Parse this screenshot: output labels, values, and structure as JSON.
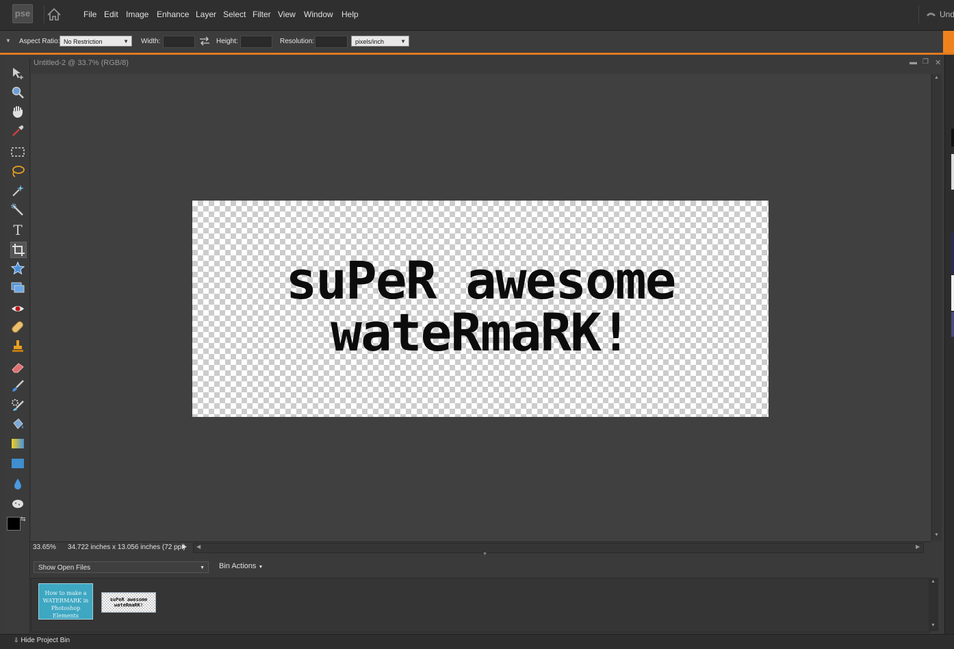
{
  "app": {
    "logo": "pse"
  },
  "menu": [
    "File",
    "Edit",
    "Image",
    "Enhance",
    "Layer",
    "Select",
    "Filter",
    "View",
    "Window",
    "Help"
  ],
  "undo_label": "Und",
  "options": {
    "aspect_label": "Aspect Ratio:",
    "aspect_value": "No Restriction",
    "width_label": "Width:",
    "height_label": "Height:",
    "resolution_label": "Resolution:",
    "units_value": "pixels/inch"
  },
  "document": {
    "title": "Untitled-2 @ 33.7% (RGB/8)",
    "zoom": "33.65%",
    "doc_size": "34.722 inches x 13.056 inches (72 ppi)",
    "text_line1": "suPeR awesome",
    "text_line2": "wateRmaRK!"
  },
  "bin": {
    "show_label": "Show Open Files",
    "actions_label": "Bin Actions",
    "thumb1_text": "How to make a WATERMARK in Photoshop Elements",
    "thumb2_text": "suPeR awesome wateRmaRK!"
  },
  "bottom": {
    "hide_bin_label": "Hide Project Bin"
  },
  "colors": {
    "accent": "#f0821e",
    "thumb1_bg": "#3ea7c2"
  }
}
